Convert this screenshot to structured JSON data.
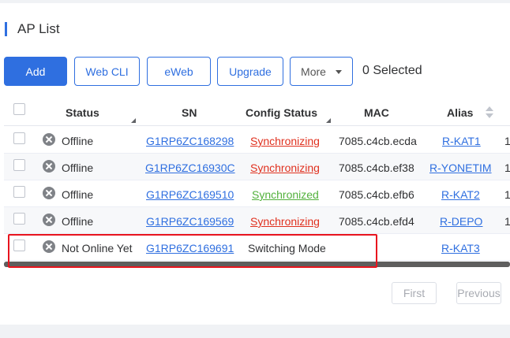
{
  "page": {
    "title": "AP List"
  },
  "toolbar": {
    "add": "Add",
    "web_cli": "Web CLI",
    "eweb": "eWeb",
    "upgrade": "Upgrade",
    "more": "More",
    "selected": "0 Selected"
  },
  "table": {
    "headers": {
      "status": "Status",
      "sn": "SN",
      "config_status": "Config Status",
      "mac": "MAC",
      "alias": "Alias"
    },
    "rows": [
      {
        "status": "Offline",
        "sn": "G1RP6ZC168298",
        "config": "Synchronizing",
        "mac": "7085.c4cb.ecda",
        "alias": "R-KAT1",
        "extra": "1"
      },
      {
        "status": "Offline",
        "sn": "G1RP6ZC16930C",
        "config": "Synchronizing",
        "mac": "7085.c4cb.ef38",
        "alias": "R-YONETIM",
        "extra": "1"
      },
      {
        "status": "Offline",
        "sn": "G1RP6ZC169510",
        "config": "Synchronized",
        "mac": "7085.c4cb.efb6",
        "alias": "R-KAT2",
        "extra": "1"
      },
      {
        "status": "Offline",
        "sn": "G1RP6ZC169569",
        "config": "Synchronizing",
        "mac": "7085.c4cb.efd4",
        "alias": "R-DEPO",
        "extra": "1"
      },
      {
        "status": "Not Online Yet",
        "sn": "G1RP6ZC169691",
        "config": "Switching Mode",
        "mac": "",
        "alias": "R-KAT3",
        "extra": ""
      }
    ]
  },
  "pager": {
    "first": "First",
    "previous": "Previous"
  },
  "colors": {
    "accent": "#2f6fe0",
    "error": "#e0301e",
    "success": "#52b13c",
    "highlight": "#e8141e"
  }
}
